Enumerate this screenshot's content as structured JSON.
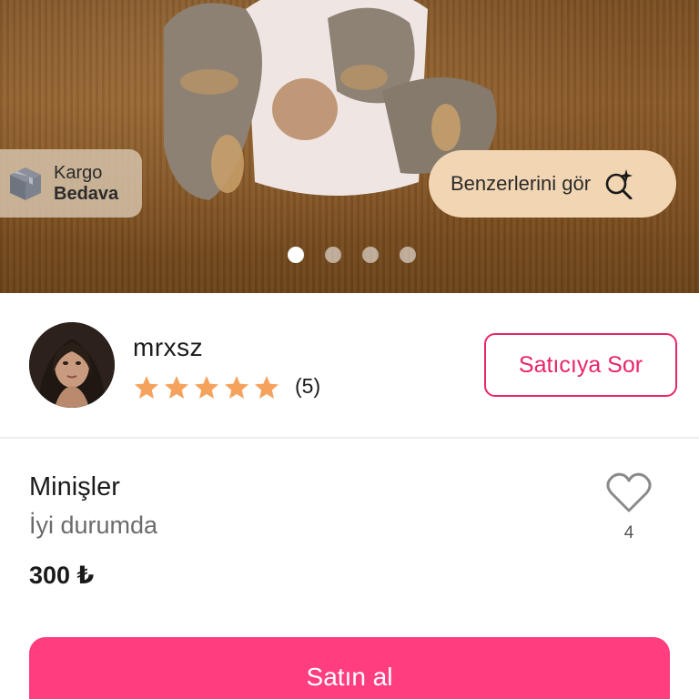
{
  "hero": {
    "badge": {
      "line1": "Kargo",
      "line2": "Bedava",
      "icon": "package-box-icon"
    },
    "similar_button": {
      "label": "Benzerlerini gör",
      "icon": "sparkle-search-icon"
    },
    "carousel": {
      "total": 4,
      "active_index": 0
    }
  },
  "seller": {
    "name": "mrxsz",
    "rating_stars": 5,
    "rating_count": "(5)",
    "ask_button": "Satıcıya Sor"
  },
  "product": {
    "title": "Minişler",
    "condition": "İyi durumda",
    "price": "300 ₺",
    "likes": "4"
  },
  "actions": {
    "buy_label": "Satın al"
  },
  "colors": {
    "accent": "#ff3d7f",
    "accent_border": "#e8246a",
    "star": "#f5a25d",
    "chip": "#f2d6b3"
  }
}
